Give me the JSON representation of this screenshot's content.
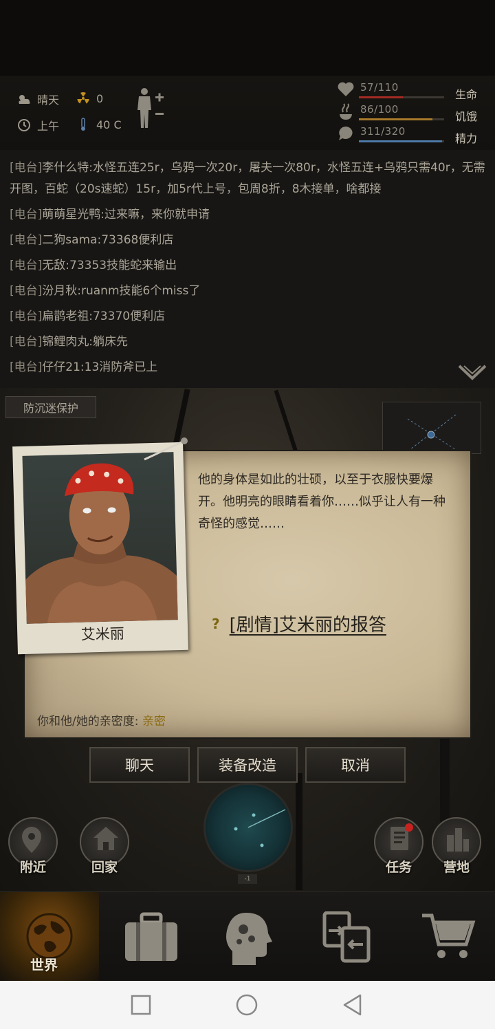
{
  "status": {
    "weather": "晴天",
    "radiation": "0",
    "time_of_day": "上午",
    "temperature": "40 C",
    "stats": [
      {
        "icon": "heart-icon",
        "value": "57/110",
        "fill": 0.518,
        "color": "#a42a22",
        "label": "生命"
      },
      {
        "icon": "food-icon",
        "value": "86/100",
        "fill": 0.86,
        "color": "#a87a2a",
        "label": "饥饿"
      },
      {
        "icon": "energy-icon",
        "value": "311/320",
        "fill": 0.972,
        "color": "#4d7aa8",
        "label": "精力"
      }
    ]
  },
  "chat": {
    "tag": "[电台]",
    "lines": [
      "李什么特:水怪五连25r，乌鸦一次20r，屠夫一次80r，水怪五连+乌鸦只需40r，无需开图，百蛇（20s速蛇）15r，加5r代上号，包周8折，8木接单，啥都接",
      "萌萌星光鸭:过来嘛，来你就申请",
      "二狗sama:73368便利店",
      "无敌:73353技能蛇来输出",
      "汾月秋:ruanm技能6个miss了",
      "扁鹊老祖:73370便利店",
      "锦鲤肉丸:躺床先",
      "仔仔21:13消防斧已上"
    ]
  },
  "anti_addiction": "防沉迷保护",
  "dialog": {
    "npc_name": "艾米丽",
    "description": "他的身体是如此的壮硕，以至于衣服快要爆开。他明亮的眼睛看着你……似乎让人有一种奇怪的感觉……",
    "quest_mark": "?",
    "quest": "[剧情]艾米丽的报答",
    "intimacy_label": "你和他/她的亲密度:",
    "intimacy_level": "亲密"
  },
  "actions": {
    "chat": "聊天",
    "equip": "装备改造",
    "cancel": "取消"
  },
  "radar_tag": "-1",
  "side": {
    "nearby": "附近",
    "home": "回家",
    "tasks": "任务",
    "camp": "营地"
  },
  "nav": {
    "world": "世界"
  }
}
